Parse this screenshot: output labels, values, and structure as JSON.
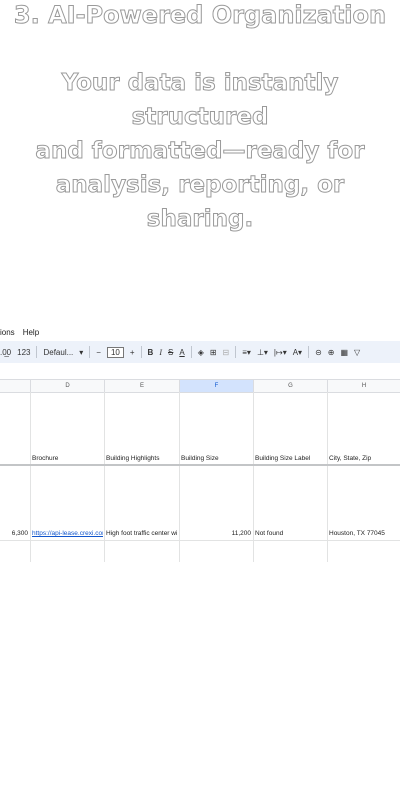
{
  "promo": {
    "heading": "3. AI-Powered Organization",
    "line1": "Your data is instantly structured",
    "line2": "and formatted—ready for",
    "line3": "analysis, reporting, or sharing."
  },
  "menu": {
    "items": [
      "ions",
      "Help"
    ]
  },
  "toolbar": {
    "format_num": "123",
    "font": "Defaul...",
    "font_size": "10",
    "minus": "−",
    "plus": "+",
    "bold": "B",
    "italic": "I",
    "strike": "S",
    "text_color": "A"
  },
  "columns": [
    "D",
    "E",
    "F",
    "G",
    "H"
  ],
  "selected_column": "F",
  "headers": {
    "d": "Brochure",
    "e": "Building Highlights",
    "f": "Building Size",
    "g": "Building Size Label",
    "h": "City, State, Zip"
  },
  "row": {
    "c": "6,300",
    "d": "https://api-lease.crexi.cor",
    "e": "High foot traffic center wi",
    "f": "11,200",
    "g": "Not found",
    "h": "Houston, TX 77045"
  }
}
